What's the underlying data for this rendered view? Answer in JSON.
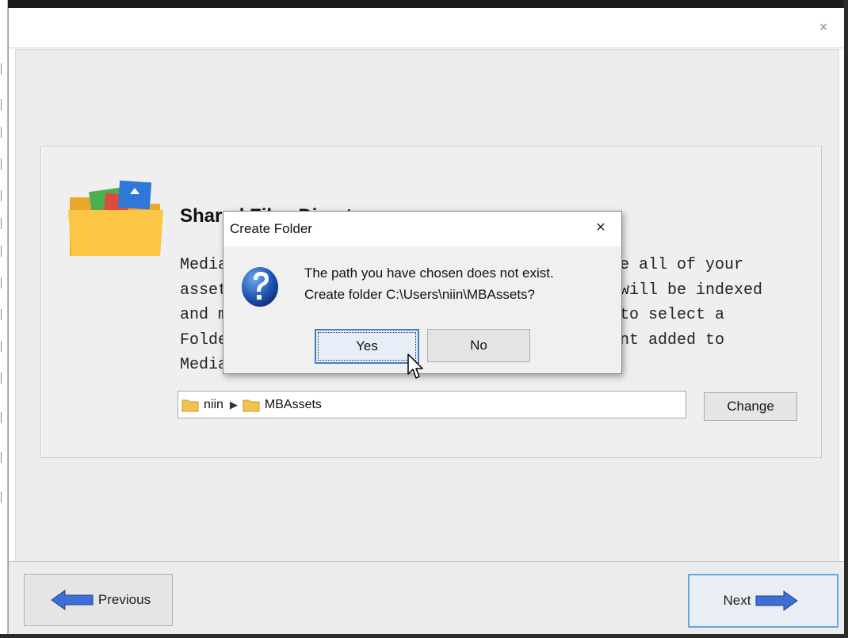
{
  "wizard": {
    "close_glyph": "×",
    "panel": {
      "title": "Shared Files Directory",
      "description_lines": [
        "Media",
        "asset",
        "and m",
        "Folde",
        "Media"
      ],
      "description_right_lines": [
        "e all of your",
        "will be indexed",
        "to select a",
        "nt added to",
        ""
      ],
      "path": {
        "crumb_1": "niin",
        "separator": "▶",
        "crumb_2": "MBAssets"
      },
      "change_label": "Change"
    },
    "footer": {
      "previous_label": "Previous",
      "next_label": "Next"
    }
  },
  "dialog": {
    "title": "Create Folder",
    "close_glyph": "×",
    "message_line_1": "The path you have chosen does not exist.",
    "message_line_2": "Create folder C:\\Users\\niin\\MBAssets?",
    "yes_label": "Yes",
    "no_label": "No",
    "icon": "question-icon"
  },
  "colors": {
    "folder_yellow": "#fbc645",
    "arrow_blue": "#3d6fd6",
    "focus_blue": "#3c7fc9"
  }
}
